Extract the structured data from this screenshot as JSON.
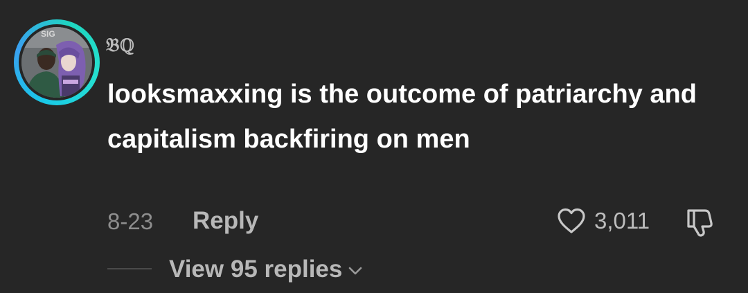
{
  "comment": {
    "username": "𝔅ℚ",
    "text": "looksmaxxing is the outcome of patriarchy and capitalism backfiring on men",
    "date": "8-23",
    "reply_label": "Reply",
    "like_count": "3,011",
    "view_replies_label": "View 95 replies"
  },
  "icons": {
    "like": "heart-outline-icon",
    "dislike": "thumbs-down-outline-icon",
    "expand": "chevron-down-icon"
  },
  "colors": {
    "background": "#262626",
    "text_primary": "#ffffff",
    "text_secondary": "#8e8e8e",
    "avatar_ring": "#19c8e8"
  }
}
